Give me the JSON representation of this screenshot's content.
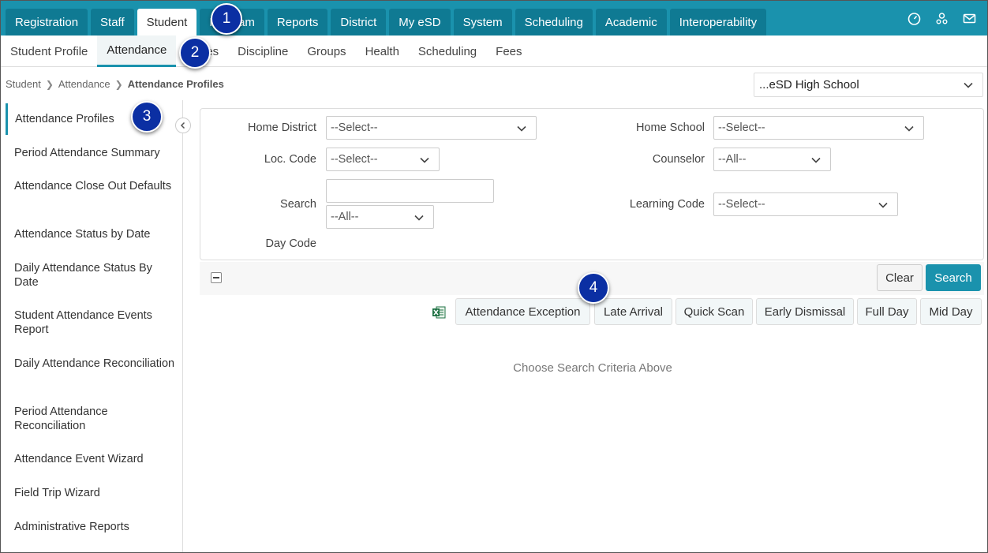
{
  "topnav": {
    "tabs": [
      "Registration",
      "Staff",
      "Student",
      "Program",
      "Reports",
      "District",
      "My eSD",
      "System",
      "Scheduling",
      "Academic",
      "Interoperability"
    ],
    "active": "Student",
    "icons": [
      "dashboard-icon",
      "users-icon",
      "mail-icon"
    ]
  },
  "subnav": {
    "items": [
      "Student Profile",
      "Attendance",
      "Fees",
      "Discipline",
      "Groups",
      "Health",
      "Scheduling",
      "Fees"
    ],
    "item_partial": "es",
    "active": "Attendance"
  },
  "breadcrumb": {
    "items": [
      "Student",
      "Attendance",
      "Attendance Profiles"
    ]
  },
  "school_select": {
    "value": "...eSD High School"
  },
  "sidebar": {
    "items": [
      "Attendance Profiles",
      "Period Attendance Summary",
      "Attendance Close Out Defaults",
      "Attendance Status by Date",
      "Daily Attendance Status By Date",
      "Student Attendance Events Report",
      "Daily Attendance Reconciliation",
      "Period Attendance Reconciliation",
      "Attendance Event Wizard",
      "Field Trip Wizard",
      "Administrative Reports"
    ],
    "active": "Attendance Profiles"
  },
  "form": {
    "home_district": {
      "label": "Home District",
      "value": "--Select--"
    },
    "home_school": {
      "label": "Home School",
      "value": "--Select--"
    },
    "loc_code": {
      "label": "Loc. Code",
      "value": "--Select--"
    },
    "counselor": {
      "label": "Counselor",
      "value": "--All--"
    },
    "search": {
      "label": "Search",
      "value": "",
      "scope": "--All--"
    },
    "learning_code": {
      "label": "Learning Code",
      "value": "--Select--"
    },
    "day_code": {
      "label": "Day Code"
    }
  },
  "buttons": {
    "clear": "Clear",
    "search": "Search"
  },
  "actions": [
    "Attendance Exception",
    "Late Arrival",
    "Quick Scan",
    "Early Dismissal",
    "Full Day",
    "Mid Day"
  ],
  "empty_message": "Choose Search Criteria Above",
  "callouts": [
    "1",
    "2",
    "3",
    "4"
  ],
  "colors": {
    "accent": "#1a92ad",
    "accent_dark": "#0f7a93",
    "callout": "#0b2fa3"
  }
}
